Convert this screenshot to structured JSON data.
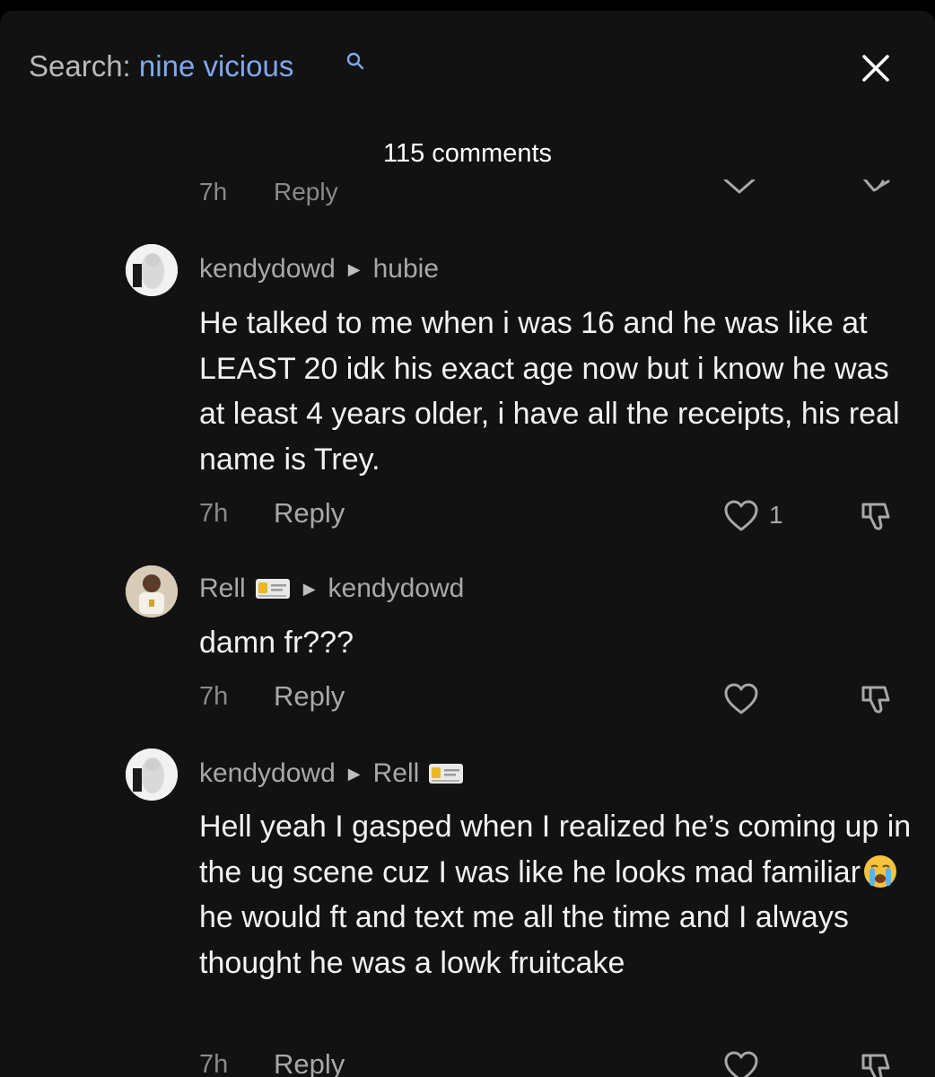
{
  "search": {
    "label": "Search: ",
    "term": "nine vicious"
  },
  "header": {
    "comment_count": "115 comments"
  },
  "partial_row": {
    "time": "7h",
    "reply": "Reply"
  },
  "comments": [
    {
      "author": "kendydowd",
      "reply_to": "hubie",
      "text": "He talked to me when i was 16 and he was like at LEAST 20 idk his exact age now but i know he was at least 4 years older, i have all the receipts, his real name is Trey.",
      "time": "7h",
      "reply_label": "Reply",
      "likes": "1"
    },
    {
      "author": "Rell",
      "reply_to": "kendydowd",
      "text": "damn fr???",
      "time": "7h",
      "reply_label": "Reply"
    },
    {
      "author": "kendydowd",
      "reply_to": "Rell",
      "text_before_emoji": "Hell yeah I gasped when I realized he’s coming up in the ug scene cuz I was like he looks mad familiar",
      "emoji": "loudly-crying-face-emoji",
      "text_after_emoji": " he would ft and text me all the time and I always thought he was a lowk fruitcake",
      "time": "7h",
      "reply_label": "Reply"
    }
  ],
  "colors": {
    "background": "#121212",
    "search_term": "#7ea8ee",
    "secondary_text": "#a8a8a8"
  }
}
